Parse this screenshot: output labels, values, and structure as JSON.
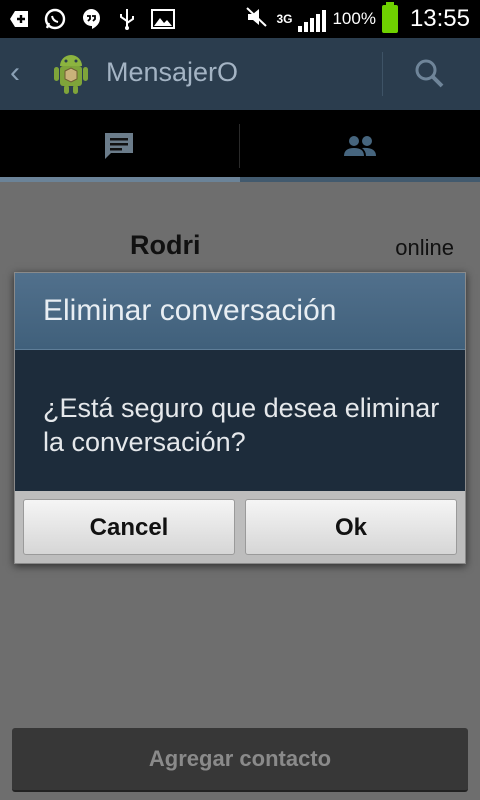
{
  "status_bar": {
    "icons_left": [
      "add-icon",
      "whatsapp-icon",
      "hangouts-icon",
      "usb-icon",
      "image-icon"
    ],
    "mute_icon": "mute-icon",
    "network": "3G",
    "battery_percent": "100%",
    "time": "13:55"
  },
  "action_bar": {
    "title": "MensajerO",
    "search_icon": "search-icon"
  },
  "tabs": [
    {
      "name": "chats",
      "icon": "chat-icon",
      "selected": true
    },
    {
      "name": "contacts",
      "icon": "people-icon",
      "selected": false
    }
  ],
  "contact": {
    "name": "Rodri",
    "status": "online"
  },
  "dialog": {
    "title": "Eliminar conversación",
    "message": "¿Está seguro que desea eliminar la conversación?",
    "cancel_label": "Cancel",
    "ok_label": "Ok"
  },
  "add_contact_label": "Agregar contacto",
  "colors": {
    "action_bar": "#2b3d4e",
    "dialog_header": "#4a6985",
    "dialog_body": "#1d2c3b",
    "battery": "#6fd100"
  }
}
